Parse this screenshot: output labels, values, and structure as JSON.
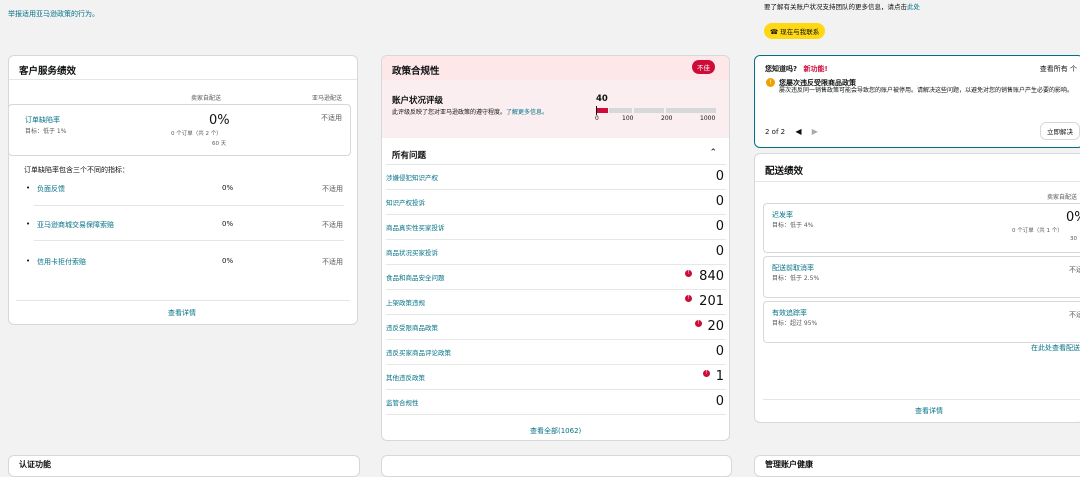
{
  "top_note": "举报适用亚马逊政策的行为。",
  "notice": {
    "text": "要了解有关账户状况支持团队的更多信息，请点击",
    "link": "此处",
    "button": "现在与我联系"
  },
  "customer_service": {
    "title": "客户服务绩效",
    "col_seller": "卖家自配送",
    "col_amazon": "亚马逊配送",
    "odr": {
      "label": "订单缺陷率",
      "target": "目标：低于 1%",
      "value": "0%",
      "detail": "0 个订单（共 2 个）",
      "period": "60 天",
      "amazon": "不适用"
    },
    "odr_intro": "订单缺陷率包含三个不同的指标：",
    "sub_metrics": [
      {
        "label": "负面反馈",
        "value": "0%",
        "amazon": "不适用"
      },
      {
        "label": "亚马逊商城交易保障索赔",
        "value": "0%",
        "amazon": "不适用"
      },
      {
        "label": "信用卡拒付索赔",
        "value": "0%",
        "amazon": "不适用"
      }
    ],
    "view_details": "查看详情"
  },
  "policy": {
    "title": "政策合规性",
    "status_badge": "不佳",
    "ahr_title": "账户状况评级",
    "ahr_desc": "此评级反映了您对亚马逊政策的遵守程度。",
    "ahr_link": "了解更多信息。",
    "ahr_value": "40",
    "ahr_scale": [
      "0",
      "100",
      "200",
      "1000"
    ],
    "issues_title": "所有问题",
    "issues": [
      {
        "label": "涉嫌侵犯知识产权",
        "count": "0",
        "alert": false
      },
      {
        "label": "知识产权投诉",
        "count": "0",
        "alert": false
      },
      {
        "label": "商品真实性买家投诉",
        "count": "0",
        "alert": false
      },
      {
        "label": "商品状况买家投诉",
        "count": "0",
        "alert": false
      },
      {
        "label": "食品和商品安全问题",
        "count": "840",
        "alert": true
      },
      {
        "label": "上架政策违规",
        "count": "201",
        "alert": true
      },
      {
        "label": "违反受限商品政策",
        "count": "20",
        "alert": true
      },
      {
        "label": "违反买家商品评论政策",
        "count": "0",
        "alert": false
      },
      {
        "label": "其他违反政策",
        "count": "1",
        "alert": true
      },
      {
        "label": "监管合规性",
        "count": "0",
        "alert": false
      }
    ],
    "view_all": "查看全部(1062)"
  },
  "did_you_know": {
    "title": "您知道吗?",
    "new_feature": "新功能!",
    "view_all": "查看所有 个",
    "headline": "您屡次违反受限商品政策",
    "body": "屡次违反同一销售政策可能会导致您的账户被停用。请解决这些问题，以避免对您的销售账户产生必要的影响。",
    "pager": "2 of 2",
    "action_button": "立即解决"
  },
  "shipping": {
    "title": "配送绩效",
    "col_seller": "卖家自配送",
    "metrics": [
      {
        "label": "迟发率",
        "target": "目标：低于 4%",
        "value": "0%",
        "detail": "0 个订单（共 1 个）",
        "period": "30"
      },
      {
        "label": "配送前取消率",
        "target": "目标：低于 2.5%",
        "value": "不适"
      },
      {
        "label": "有效追踪率",
        "target": "目标：超过 95%",
        "value": "不适"
      }
    ],
    "view_more": "在此处查看配送",
    "view_details": "查看详情"
  },
  "bottom": {
    "left_title": "认证功能",
    "right_title": "管理账户健康"
  },
  "colors": {
    "link": "#007185",
    "alert": "#cc0c39",
    "button_yellow": "#ffd814",
    "policy_header_bg": "#fde7e9"
  }
}
